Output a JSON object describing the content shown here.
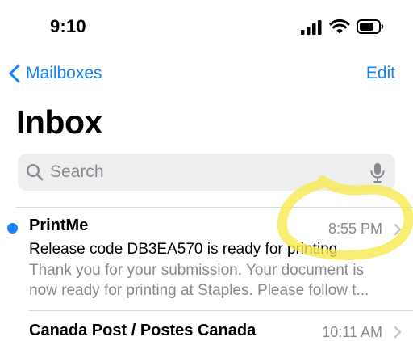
{
  "status_bar": {
    "time": "9:10",
    "icons": [
      "cellular-signal-icon",
      "wifi-icon",
      "battery-icon"
    ]
  },
  "nav": {
    "back_label": "Mailboxes",
    "edit_label": "Edit"
  },
  "title": "Inbox",
  "search": {
    "placeholder": "Search",
    "icons": [
      "search-icon",
      "microphone-icon"
    ]
  },
  "messages": [
    {
      "sender": "PrintMe",
      "time": "8:55 PM",
      "unread": true,
      "subject": "Release code DB3EA570 is ready for printing",
      "preview_line1": "Thank you for your submission. Your document is",
      "preview_line2": "now ready for printing at Staples. Please follow t..."
    },
    {
      "sender": "Canada Post / Postes Canada",
      "time": "10:11 AM",
      "unread": false
    }
  ],
  "colors": {
    "accent": "#1a80f4",
    "secondary_text": "#8a8a8e",
    "search_bg": "#eeeef0",
    "highlight_marker": "#f7e84a"
  }
}
